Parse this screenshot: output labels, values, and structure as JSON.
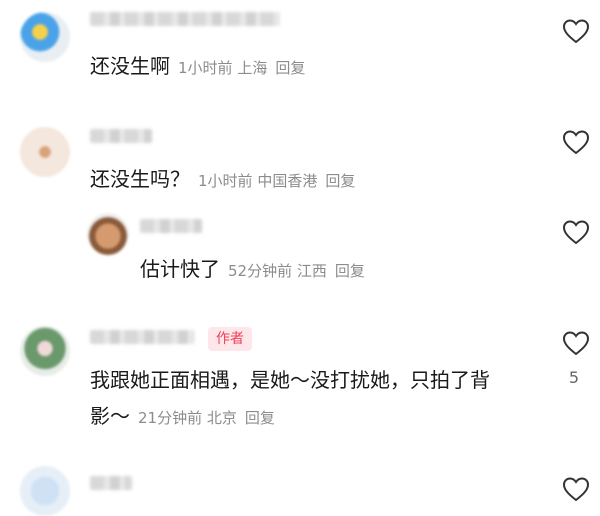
{
  "comments": [
    {
      "text": "还没生啊",
      "time": "1小时前",
      "location": "上海",
      "reply": "回复",
      "likes": ""
    },
    {
      "text": "还没生吗？",
      "time": "1小时前",
      "location": "中国香港",
      "reply": "回复",
      "likes": ""
    },
    {
      "text": "估计快了",
      "time": "52分钟前",
      "location": "江西",
      "reply": "回复",
      "likes": ""
    },
    {
      "text_line1": "我跟她正面相遇，是她～没打扰她，只拍了背",
      "text_line2": "影～",
      "time": "21分钟前",
      "location": "北京",
      "reply": "回复",
      "likes": "5",
      "badge": "作者"
    },
    {
      "likes": ""
    }
  ],
  "colors": {
    "badge_bg": "#fde7ea",
    "badge_text": "#f0405a",
    "meta": "#8c8c8c"
  },
  "icons": {
    "like": "heart-outline-icon"
  }
}
